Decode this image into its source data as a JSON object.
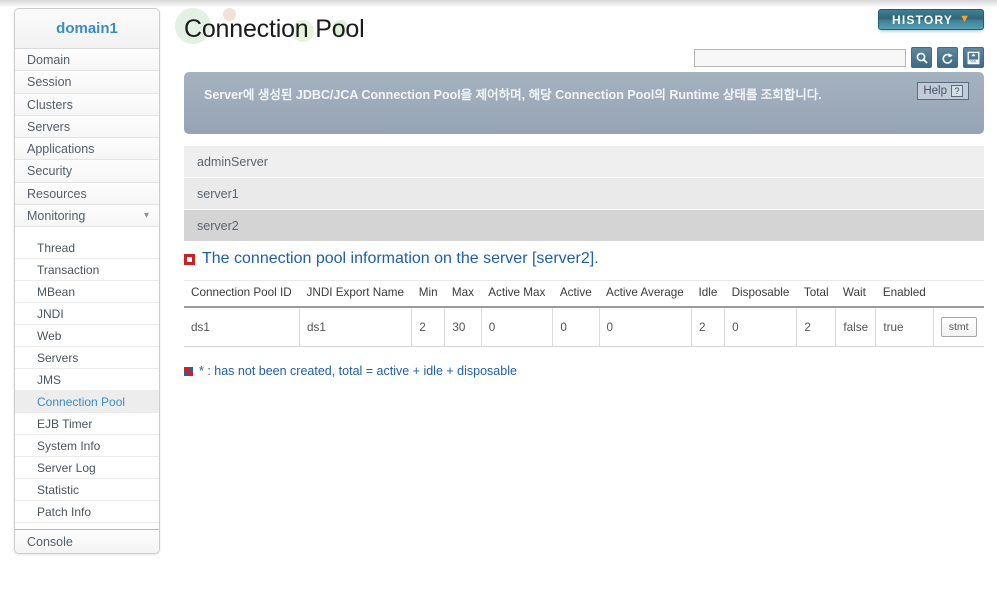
{
  "sidebar": {
    "domain_label": "domain1",
    "items": [
      {
        "label": "Domain"
      },
      {
        "label": "Session"
      },
      {
        "label": "Clusters"
      },
      {
        "label": "Servers"
      },
      {
        "label": "Applications"
      },
      {
        "label": "Security"
      },
      {
        "label": "Resources"
      },
      {
        "label": "Monitoring",
        "expanded": true,
        "chevron": "chevron-down-icon"
      }
    ],
    "submenu": [
      {
        "label": "Thread"
      },
      {
        "label": "Transaction"
      },
      {
        "label": "MBean"
      },
      {
        "label": "JNDI"
      },
      {
        "label": "Web"
      },
      {
        "label": "Servers"
      },
      {
        "label": "JMS"
      },
      {
        "label": "Connection Pool",
        "active": true
      },
      {
        "label": "EJB Timer"
      },
      {
        "label": "System Info"
      },
      {
        "label": "Server Log"
      },
      {
        "label": "Statistic"
      },
      {
        "label": "Patch Info"
      }
    ],
    "console_label": "Console"
  },
  "header": {
    "page_title": "Connection Pool",
    "history_label": "HISTORY",
    "history_caret": "chevron-down-icon",
    "search_value": "",
    "search_placeholder": "",
    "buttons": [
      {
        "name": "search-icon",
        "title": "Search"
      },
      {
        "name": "refresh-icon",
        "title": "Refresh"
      },
      {
        "name": "export-xml-icon",
        "title": "XML"
      }
    ]
  },
  "banner": {
    "text": "Server에 생성된 JDBC/JCA Connection Pool을 제어하며, 해당 Connection Pool의 Runtime 상태를 조회합니다.",
    "help_label": "Help",
    "help_mark": "?",
    "background_color": "#9aa8b8"
  },
  "servers": [
    {
      "name": "adminServer",
      "selected": false
    },
    {
      "name": "server1",
      "selected": false
    },
    {
      "name": "server2",
      "selected": true
    }
  ],
  "section": {
    "bullet_icon": "square-bullet-icon",
    "title": "The connection pool information on the server [server2].",
    "title_color": "#1f5fa8"
  },
  "table": {
    "columns": [
      "Connection Pool ID",
      "JNDI Export Name",
      "Min",
      "Max",
      "Active Max",
      "Active",
      "Active Average",
      "Idle",
      "Disposable",
      "Total",
      "Wait",
      "Enabled",
      ""
    ],
    "rows": [
      {
        "connection_pool_id": "ds1",
        "jndi_export_name": "ds1",
        "min": "2",
        "max": "30",
        "active_max": "0",
        "active": "0",
        "active_average": "0",
        "idle": "2",
        "disposable": "0",
        "total": "2",
        "wait": "false",
        "enabled": "true",
        "action_label": "stmt"
      }
    ]
  },
  "footnote": {
    "icon": "square-bullet-icon",
    "text": "* : has not been created, total = active + idle + disposable"
  }
}
